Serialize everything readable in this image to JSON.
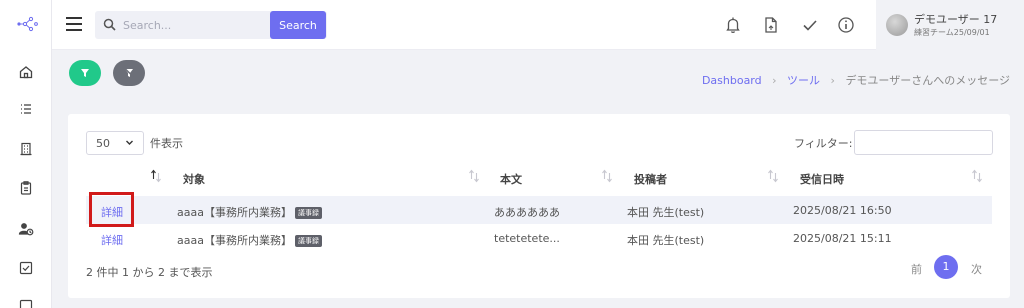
{
  "search": {
    "placeholder": "Search...",
    "button_label": "Search"
  },
  "user": {
    "name": "デモユーザー 17",
    "team": "練習チーム25/09/01"
  },
  "breadcrumb": {
    "items": [
      "Dashboard",
      "ツール"
    ],
    "current": "デモユーザーさんへのメッセージ"
  },
  "table_controls": {
    "page_length": "50",
    "page_length_suffix": "件表示",
    "filter_label": "フィルター:"
  },
  "table": {
    "columns": [
      "対象",
      "本文",
      "投稿者",
      "受信日時"
    ],
    "rows": [
      {
        "action": "詳細",
        "target": "aaaa【事務所内業務】",
        "tag": "議事録",
        "body": "ああああああ",
        "poster": "本田 先生(test)",
        "received": "2025/08/21 16:50"
      },
      {
        "action": "詳細",
        "target": "aaaa【事務所内業務】",
        "tag": "議事録",
        "body": "tetetetete...",
        "poster": "本田 先生(test)",
        "received": "2025/08/21 15:11"
      }
    ]
  },
  "info_text": "2 件中 1 から 2 まで表示",
  "pagination": {
    "prev": "前",
    "current": "1",
    "next": "次"
  },
  "colors": {
    "accent": "#6e6ef0",
    "filter_green": "#21c98a",
    "filter_gray": "#6c6f78",
    "highlight": "#d11a1a"
  },
  "icons": [
    "logo-icon",
    "home-icon",
    "list-icon",
    "building-icon",
    "clipboard-icon",
    "user-clock-icon",
    "checkbox-icon",
    "bell-icon",
    "file-icon",
    "check-icon",
    "info-icon",
    "filter-icon",
    "filter-clear-icon",
    "search-icon"
  ]
}
